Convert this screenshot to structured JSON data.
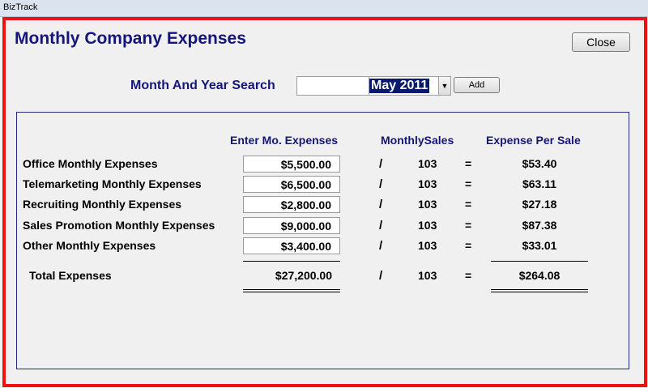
{
  "window": {
    "app_title": "BizTrack"
  },
  "page": {
    "title": "Monthly Company Expenses",
    "close_label": "Close"
  },
  "search": {
    "label": "Month And Year Search",
    "value": "",
    "selected_month": "May 2011",
    "add_label": "Add"
  },
  "table": {
    "headers": {
      "expenses": "Enter Mo. Expenses",
      "sales": "MonthlySales",
      "per_sale": "Expense Per Sale"
    },
    "rows": [
      {
        "label": "Office Monthly Expenses",
        "amount": "$5,500.00",
        "op": "/",
        "sales": "103",
        "eq": "=",
        "per_sale": "$53.40"
      },
      {
        "label": "Telemarketing Monthly Expenses",
        "amount": "$6,500.00",
        "op": "/",
        "sales": "103",
        "eq": "=",
        "per_sale": "$63.11"
      },
      {
        "label": "Recruiting Monthly Expenses",
        "amount": "$2,800.00",
        "op": "/",
        "sales": "103",
        "eq": "=",
        "per_sale": "$27.18"
      },
      {
        "label": "Sales Promotion Monthly Expenses",
        "amount": "$9,000.00",
        "op": "/",
        "sales": "103",
        "eq": "=",
        "per_sale": "$87.38"
      },
      {
        "label": "Other Monthly Expenses",
        "amount": "$3,400.00",
        "op": "/",
        "sales": "103",
        "eq": "=",
        "per_sale": "$33.01"
      }
    ],
    "total": {
      "label": "Total Expenses",
      "amount": "$27,200.00",
      "op": "/",
      "sales": "103",
      "eq": "=",
      "per_sale": "$264.08"
    }
  },
  "colors": {
    "frame_border": "#ee1111",
    "title_blue": "#15157c",
    "selection": "#0a1a6b"
  }
}
